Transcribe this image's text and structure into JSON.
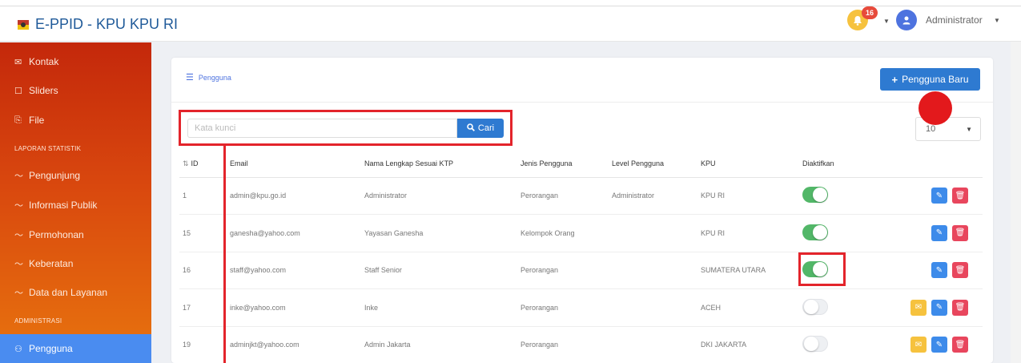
{
  "app": {
    "title": "E-PPID - KPU KPU RI",
    "user": "Administrator",
    "notif_count": "16"
  },
  "sidebar": {
    "items": [
      {
        "label": "Kontak",
        "icon": "envelope-icon"
      },
      {
        "label": "Sliders",
        "icon": "square-icon"
      },
      {
        "label": "File",
        "icon": "file-icon"
      }
    ],
    "section_stats": "LAPORAN STATISTIK",
    "stats_items": [
      {
        "label": "Pengunjung",
        "icon": "chart-line-icon"
      },
      {
        "label": "Informasi Publik",
        "icon": "chart-line-icon"
      },
      {
        "label": "Permohonan",
        "icon": "chart-line-icon"
      },
      {
        "label": "Keberatan",
        "icon": "chart-line-icon"
      },
      {
        "label": "Data dan Layanan",
        "icon": "chart-line-icon"
      }
    ],
    "section_admin": "ADMINISTRASI",
    "active_item": {
      "label": "Pengguna",
      "icon": "users-icon"
    }
  },
  "main": {
    "breadcrumb": "Pengguna",
    "new_button": "Pengguna Baru",
    "search": {
      "placeholder": "Kata kunci",
      "button": "Cari"
    },
    "page_size": "10"
  },
  "table": {
    "headers": [
      "ID",
      "Email",
      "Nama Lengkap Sesuai KTP",
      "Jenis Pengguna",
      "Level Pengguna",
      "KPU",
      "Diaktifkan"
    ],
    "rows": [
      {
        "id": "1",
        "email": "admin@kpu.go.id",
        "name": "Administrator",
        "type": "Perorangan",
        "level": "Administrator",
        "kpu": "KPU RI",
        "active": true
      },
      {
        "id": "15",
        "email": "ganesha@yahoo.com",
        "name": "Yayasan Ganesha",
        "type": "Kelompok Orang",
        "level": "",
        "kpu": "KPU RI",
        "active": true
      },
      {
        "id": "16",
        "email": "staff@yahoo.com",
        "name": "Staff Senior",
        "type": "Perorangan",
        "level": "",
        "kpu": "SUMATERA UTARA",
        "active": true
      },
      {
        "id": "17",
        "email": "inke@yahoo.com",
        "name": "Inke",
        "type": "Perorangan",
        "level": "",
        "kpu": "ACEH",
        "active": false
      },
      {
        "id": "19",
        "email": "adminjkt@yahoo.com",
        "name": "Admin Jakarta",
        "type": "Perorangan",
        "level": "",
        "kpu": "DKI JAKARTA",
        "active": false
      }
    ]
  },
  "colors": {
    "primary": "#2e7ad1",
    "success": "#52b768",
    "danger": "#e8465d",
    "warning": "#f6c23e",
    "highlight": "#e3242b"
  }
}
